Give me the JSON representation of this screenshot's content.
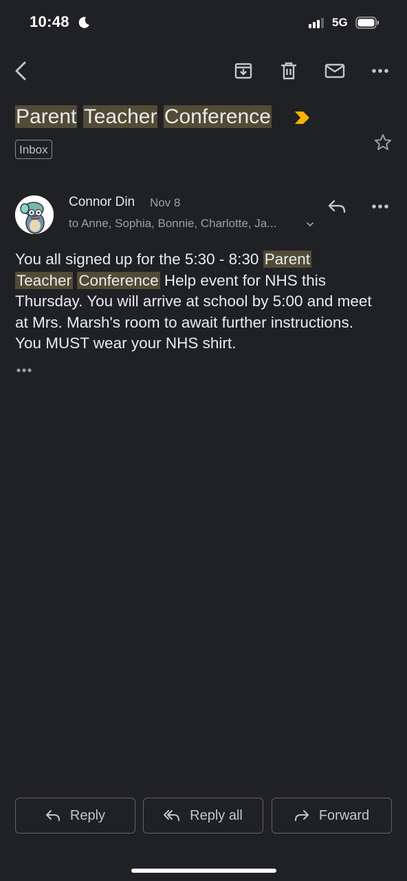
{
  "status_bar": {
    "time": "10:48",
    "network": "5G",
    "icons": [
      "moon-icon",
      "signal-icon",
      "battery-icon"
    ]
  },
  "toolbar": {
    "icons": [
      "back-icon",
      "archive-icon",
      "delete-icon",
      "mark-unread-icon",
      "more-icon"
    ]
  },
  "email": {
    "subject_words": [
      "Parent",
      "Teacher",
      "Conference"
    ],
    "label": "Inbox",
    "important_color": "#f4b400",
    "sender": "Connor Din",
    "date": "Nov 8",
    "recipients": "to Anne, Sophia, Bonnie, Charlotte, Ja...",
    "body": {
      "p1": "You all signed up for the 5:30 - 8:30 ",
      "hl1": "Parent",
      "hl2": "Teacher",
      "hl3": "Conference",
      "p2": " Help event for NHS this Thursday. You will arrive at school by 5:00 and meet at Mrs. Marsh's room to await further instructions. You MUST wear your NHS shirt."
    },
    "more_content": "•••"
  },
  "actions": {
    "reply": "Reply",
    "reply_all": "Reply all",
    "forward": "Forward"
  },
  "colors": {
    "background": "#202124",
    "highlight": "#524b36",
    "text": "#e8eaed",
    "muted": "#9aa0a6"
  }
}
